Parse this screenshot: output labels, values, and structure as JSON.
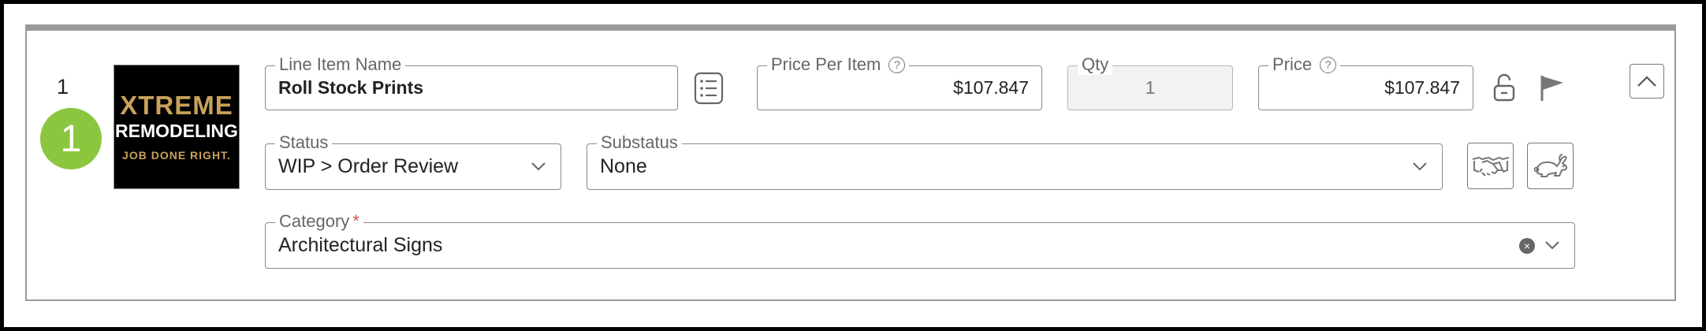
{
  "line_item": {
    "number": "1",
    "badge": "1",
    "logo": {
      "line1": "XTREME",
      "line2": "REMODELING",
      "line3": "JOB DONE RIGHT."
    },
    "name": {
      "label": "Line Item Name",
      "value": "Roll Stock Prints"
    },
    "price_per_item": {
      "label": "Price Per Item",
      "value": "$107.847"
    },
    "qty": {
      "label": "Qty",
      "value": "1"
    },
    "price": {
      "label": "Price",
      "value": "$107.847"
    },
    "status": {
      "label": "Status",
      "value": "WIP > Order Review"
    },
    "substatus": {
      "label": "Substatus",
      "value": "None"
    },
    "category": {
      "label": "Category",
      "required_mark": "*",
      "value": "Architectural Signs"
    }
  },
  "icons": {
    "list": "list-icon",
    "help": "help-circle-icon",
    "lock": "unlock-icon",
    "flag": "flag-icon",
    "collapse": "chevron-up-icon",
    "handshake": "handshake-icon",
    "rabbit": "rabbit-icon",
    "clear": "clear-circle-icon",
    "dropdown": "chevron-down-icon"
  },
  "colors": {
    "badge": "#8cc63f",
    "border": "#8a8a8a",
    "required": "#d9534f",
    "logo_gold": "#c9a15a"
  }
}
